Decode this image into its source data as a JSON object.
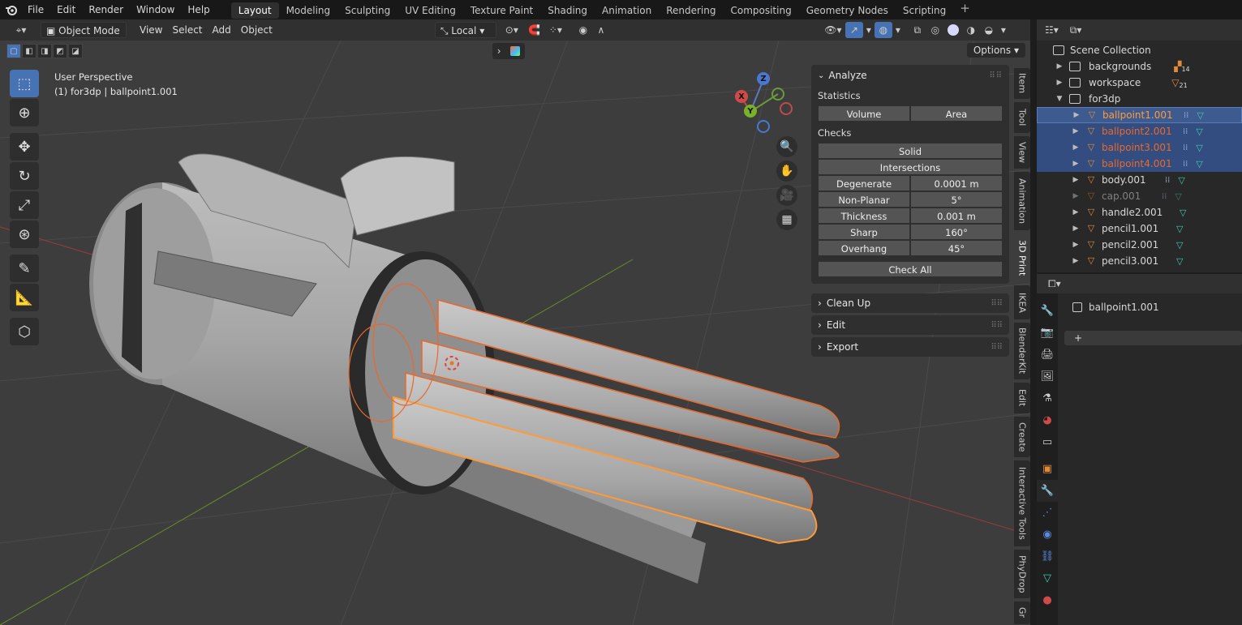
{
  "menu": [
    "File",
    "Edit",
    "Render",
    "Window",
    "Help"
  ],
  "workspaces": [
    "Layout",
    "Modeling",
    "Sculpting",
    "UV Editing",
    "Texture Paint",
    "Shading",
    "Animation",
    "Rendering",
    "Compositing",
    "Geometry Nodes",
    "Scripting"
  ],
  "active_workspace": "Layout",
  "viewport_header": {
    "mode": "Object Mode",
    "menus": [
      "View",
      "Select",
      "Add",
      "Object"
    ],
    "transform_orientation": "Local",
    "options_label": "Options"
  },
  "viewport_info": {
    "perspective": "User Perspective",
    "context": "(1) for3dp | ballpoint1.001"
  },
  "gizmo_axes": {
    "x": "X",
    "y": "Y",
    "z": "Z"
  },
  "npanel": {
    "analyze": {
      "title": "Analyze",
      "statistics_label": "Statistics",
      "volume_label": "Volume",
      "area_label": "Area",
      "checks_label": "Checks",
      "solid_label": "Solid",
      "intersections_label": "Intersections",
      "rows": [
        {
          "label": "Degenerate",
          "value": "0.0001 m"
        },
        {
          "label": "Non-Planar",
          "value": "5°"
        },
        {
          "label": "Thickness",
          "value": "0.001 m"
        },
        {
          "label": "Sharp",
          "value": "160°"
        },
        {
          "label": "Overhang",
          "value": "45°"
        }
      ],
      "check_all_label": "Check All"
    },
    "clean_up": "Clean Up",
    "edit": "Edit",
    "export": "Export"
  },
  "vertical_tabs": [
    "Item",
    "Tool",
    "View",
    "Animation",
    "3D Print",
    "IKEA",
    "BlenderKit",
    "Edit",
    "Create",
    "Interactive Tools",
    "PhyDrop",
    "Gr"
  ],
  "active_vertical_tab": "3D Print",
  "outliner": {
    "root": "Scene Collection",
    "collections": [
      {
        "name": "backgrounds",
        "badge": "14"
      },
      {
        "name": "workspace",
        "badge": "21"
      },
      {
        "name": "for3dp",
        "badge": ""
      }
    ],
    "objects": [
      {
        "name": "ballpoint1.001",
        "state": "active"
      },
      {
        "name": "ballpoint2.001",
        "state": "selected"
      },
      {
        "name": "ballpoint3.001",
        "state": "selected"
      },
      {
        "name": "ballpoint4.001",
        "state": "selected"
      },
      {
        "name": "body.001",
        "state": "normal"
      },
      {
        "name": "cap.001",
        "state": "hidden"
      },
      {
        "name": "handle2.001",
        "state": "normal"
      },
      {
        "name": "pencil1.001",
        "state": "normal"
      },
      {
        "name": "pencil2.001",
        "state": "normal"
      },
      {
        "name": "pencil3.001",
        "state": "normal"
      }
    ]
  },
  "properties": {
    "object_name": "ballpoint1.001",
    "add_label": "+"
  },
  "colors": {
    "accent": "#4772b3",
    "selected_orange": "#e8692a",
    "active_outline": "#ff8a2a",
    "mesh_green": "#3ecbb2"
  }
}
